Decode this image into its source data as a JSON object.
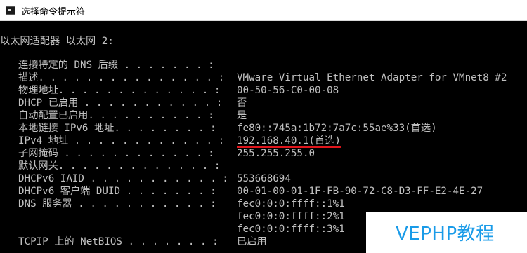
{
  "window": {
    "title": "选择命令提示符"
  },
  "section_header": "以太网适配器 以太网 2:",
  "rows": [
    {
      "label": "连接特定的 DNS 后缀 . . . . . . . :",
      "value": ""
    },
    {
      "label": "描述. . . . . . . . . . . . . . . :",
      "value": "VMware Virtual Ethernet Adapter for VMnet8 #2"
    },
    {
      "label": "物理地址. . . . . . . . . . . . . :",
      "value": "00-50-56-C0-00-08"
    },
    {
      "label": "DHCP 已启用 . . . . . . . . . . . :",
      "value": "否"
    },
    {
      "label": "自动配置已启用. . . . . . . . . . :",
      "value": "是"
    },
    {
      "label": "本地链接 IPv6 地址. . . . . . . . :",
      "value": "fe80::745a:1b72:7a7c:55ae%33(首选)"
    },
    {
      "label": "IPv4 地址 . . . . . . . . . . . . :",
      "value": "192.168.40.1(首选)"
    },
    {
      "label": "子网掩码 . . . . . . . . . . . . :",
      "value": "255.255.255.0"
    },
    {
      "label": "默认网关. . . . . . . . . . . . . :",
      "value": ""
    },
    {
      "label": "DHCPv6 IAID . . . . . . . . . . . :",
      "value": "553668694"
    },
    {
      "label": "DHCPv6 客户端 DUID . . . . . . . :",
      "value": "00-01-00-01-1F-FB-90-72-C8-D3-FF-E2-4E-27"
    },
    {
      "label": "DNS 服务器 . . . . . . . . . . . :",
      "value": "fec0:0:0:ffff::1%1"
    },
    {
      "label": "",
      "value": "fec0:0:0:ffff::2%1"
    },
    {
      "label": "",
      "value": "fec0:0:0:ffff::3%1"
    },
    {
      "label": "TCPIP 上的 NetBIOS . . . . . . . :",
      "value": "已启用"
    }
  ],
  "watermark": {
    "text": "VEPHP教程"
  },
  "colors": {
    "console_bg": "#000000",
    "console_text": "#c0c0c0",
    "underline": "#e0151b",
    "watermark_text": "#1a9be8"
  }
}
